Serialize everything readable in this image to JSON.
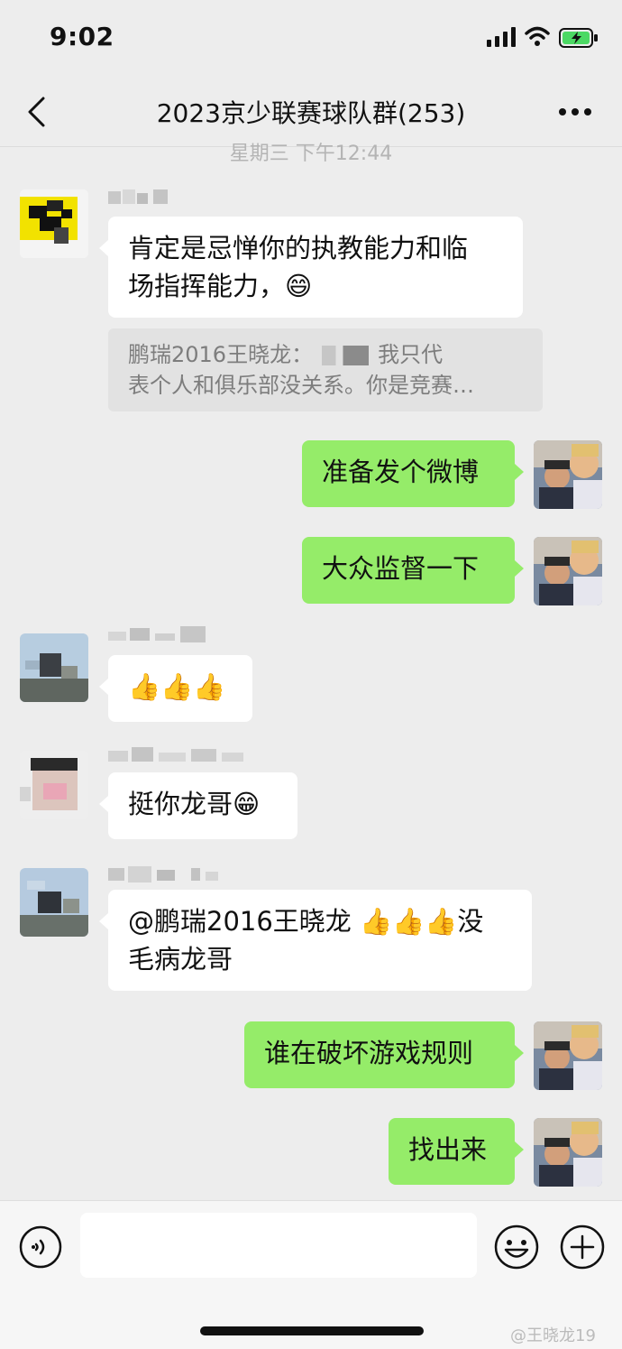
{
  "status": {
    "time": "9:02"
  },
  "nav": {
    "title": "2023京少联赛球队群(253)"
  },
  "timestamp": "星期三 下午12:44",
  "messages": [
    {
      "side": "in",
      "text": "肯定是忌惮你的执教能力和临\n场指挥能力，😄"
    },
    {
      "side": "in",
      "quote_line1": "鹏瑞2016王晓龙：",
      "quote_line1b": "我只代",
      "quote_line2": "表个人和俱乐部没关系。你是竞赛…"
    },
    {
      "side": "out",
      "text": "准备发个微博"
    },
    {
      "side": "out",
      "text": "大众监督一下"
    },
    {
      "side": "in",
      "text": "👍👍👍"
    },
    {
      "side": "in",
      "text": "挺你龙哥😁"
    },
    {
      "side": "in",
      "text": "@鹏瑞2016王晓龙 👍👍👍没\n毛病龙哥"
    },
    {
      "side": "out",
      "text": "谁在破坏游戏规则"
    },
    {
      "side": "out",
      "text": "找出来"
    }
  ],
  "input": {
    "value": ""
  },
  "icons": {
    "back": "chevron-left-icon",
    "more": "more-dots-icon",
    "voice": "voice-icon",
    "emoji": "emoji-icon",
    "plus": "plus-icon"
  },
  "colors": {
    "background": "#ededed",
    "outgoing_bubble": "#95ec69",
    "incoming_bubble": "#ffffff"
  },
  "watermark": "@王晓龙19"
}
